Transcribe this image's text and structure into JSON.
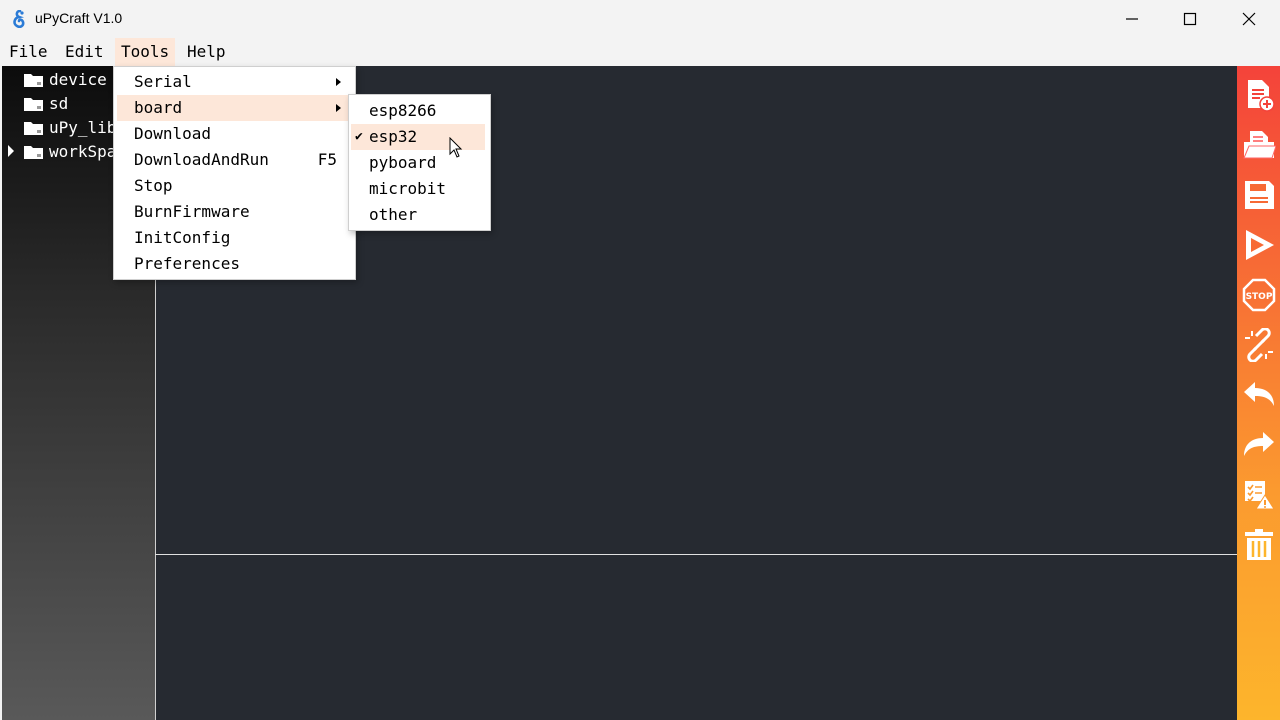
{
  "window": {
    "title": "uPyCraft V1.0"
  },
  "menubar": {
    "file": "File",
    "edit": "Edit",
    "tools": "Tools",
    "help": "Help"
  },
  "tree": {
    "items": [
      {
        "label": "device",
        "expandable": false
      },
      {
        "label": "sd",
        "expandable": false
      },
      {
        "label": "uPy_lib",
        "expandable": false
      },
      {
        "label": "workSpace",
        "expandable": true
      }
    ]
  },
  "tools_menu": {
    "items": [
      {
        "label": "Serial",
        "submenu": true
      },
      {
        "label": "board",
        "submenu": true,
        "highlighted": true
      },
      {
        "label": "Download"
      },
      {
        "label": "DownloadAndRun",
        "shortcut": "F5"
      },
      {
        "label": "Stop"
      },
      {
        "label": "BurnFirmware"
      },
      {
        "label": "InitConfig"
      },
      {
        "label": "Preferences"
      }
    ]
  },
  "board_menu": {
    "items": [
      {
        "label": "esp8266",
        "checked": false
      },
      {
        "label": "esp32",
        "checked": true,
        "highlighted": true
      },
      {
        "label": "pyboard",
        "checked": false
      },
      {
        "label": "microbit",
        "checked": false
      },
      {
        "label": "other",
        "checked": false
      }
    ]
  },
  "toolbar": {
    "icons": [
      "new-file-icon",
      "open-file-icon",
      "save-icon",
      "run-icon",
      "stop-icon",
      "connect-icon",
      "undo-icon",
      "redo-icon",
      "syntax-check-icon",
      "clear-icon"
    ]
  },
  "colors": {
    "highlight": "#fde7d9",
    "editor_bg": "#262a31",
    "toolbar_top": "#f4433a",
    "toolbar_bottom": "#fdb52c"
  }
}
